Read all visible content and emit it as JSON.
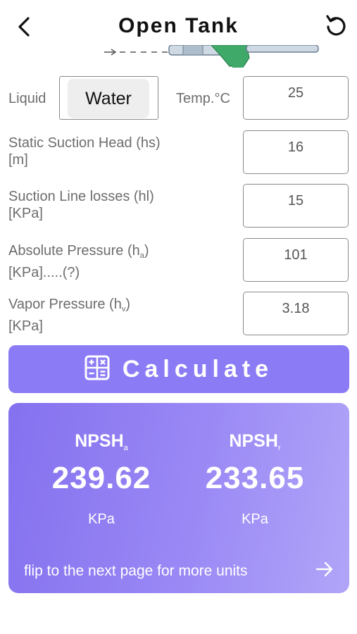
{
  "header": {
    "title": "Open Tank",
    "back_icon": "chevron-left-icon",
    "reset_icon": "rotate-ccw-icon"
  },
  "form": {
    "liquid_label": "Liquid",
    "liquid_value": "Water",
    "temp_label": "Temp.°C",
    "temp_value": "25",
    "static_head": {
      "label": "Static Suction Head (hs)",
      "unit": "[m]",
      "value": "16"
    },
    "line_losses": {
      "label": "Suction Line losses (hl)",
      "unit": "[KPa]",
      "value": "15"
    },
    "abs_pressure": {
      "label_main": "Absolute Pressure (h",
      "label_sub": "a",
      "label_end": ")",
      "unit": "[KPa].....(?)",
      "value": "101"
    },
    "vapor_pressure": {
      "label_main": "Vapor Pressure (h",
      "label_sub": "v",
      "label_end": ")",
      "unit": "[KPa]",
      "value": "3.18"
    }
  },
  "calculate": {
    "label": "Calculate",
    "icon": "calculator-icon"
  },
  "results": {
    "npsha": {
      "name": "NPSH",
      "sub": "a",
      "value": "239.62",
      "unit": "KPa"
    },
    "npshr": {
      "name": "NPSH",
      "sub": "r",
      "value": "233.65",
      "unit": "KPa"
    },
    "flip_text": "flip to the next page for more units",
    "flip_icon": "arrow-right-icon"
  },
  "colors": {
    "accent": "#8b7cf5",
    "card_start": "#8471ef",
    "card_end": "#b0a5f8",
    "label_gray": "#6d6d6d"
  }
}
